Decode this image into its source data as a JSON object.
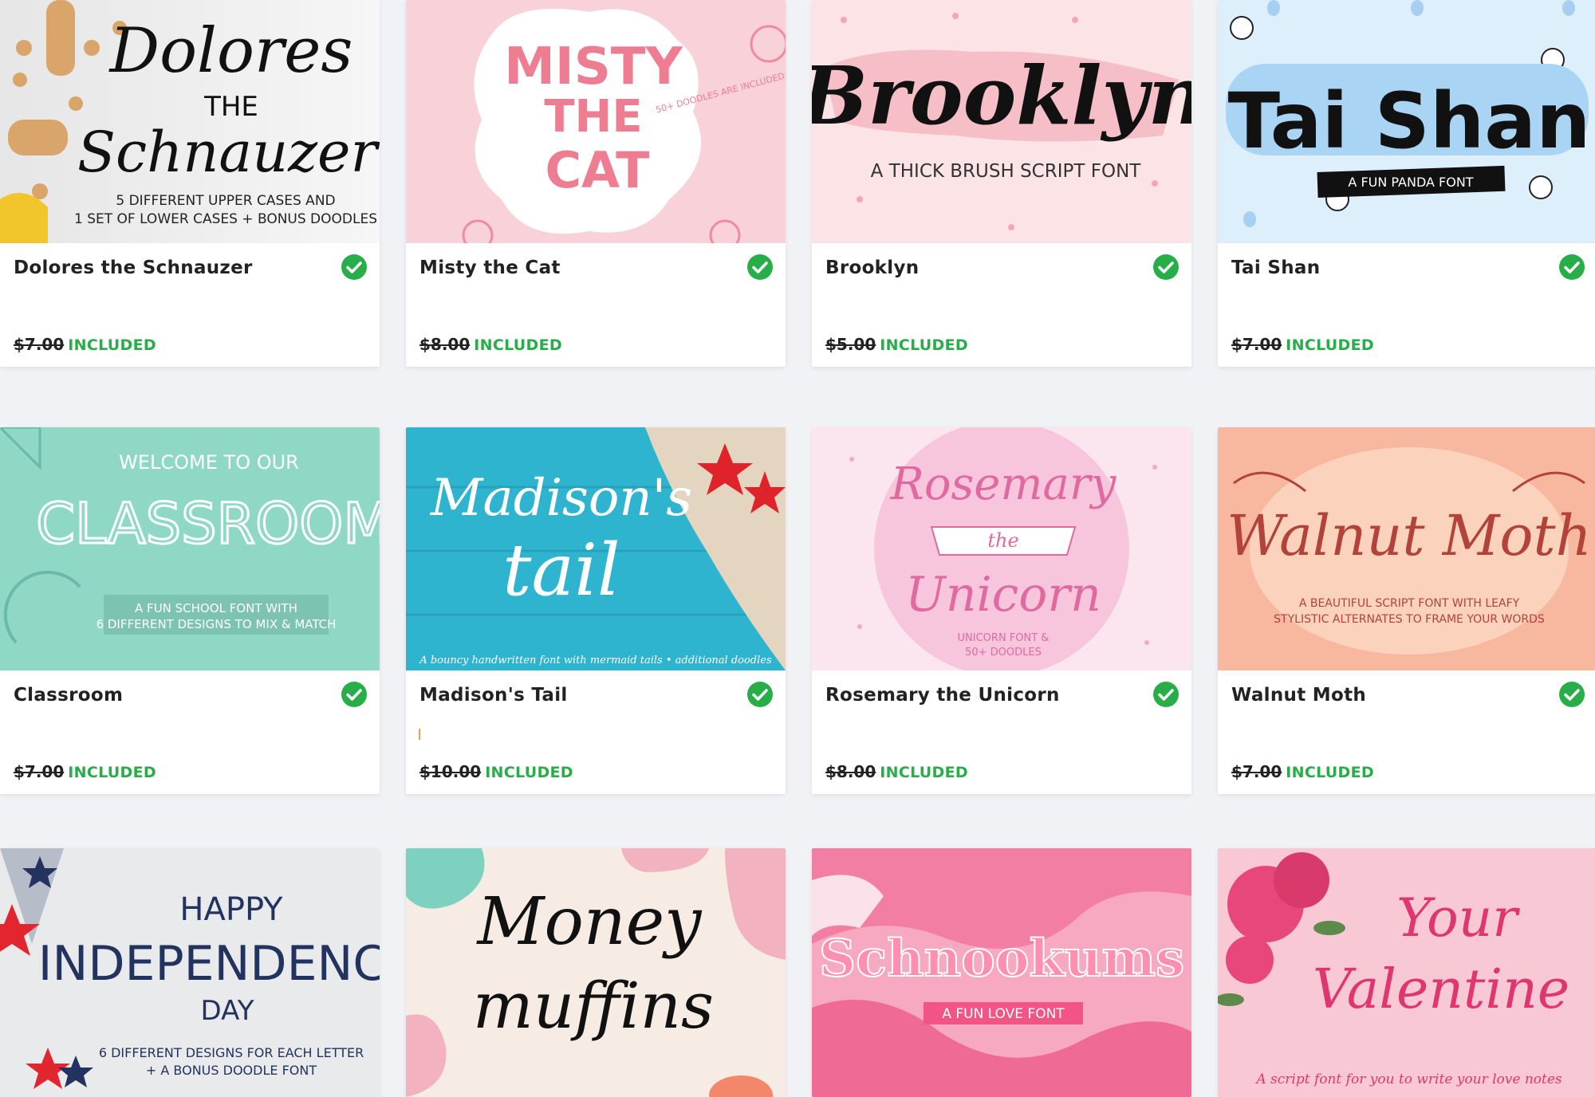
{
  "products": [
    {
      "title": "Dolores the Schnauzer",
      "price": "$7.00",
      "status": "INCLUDED",
      "thumb": {
        "lines": [
          "Dolores",
          "THE",
          "Schnauzer",
          "5 DIFFERENT UPPER CASES AND",
          "1 SET OF LOWER CASES + BONUS DOODLES"
        ]
      }
    },
    {
      "title": "Misty the Cat",
      "price": "$8.00",
      "status": "INCLUDED",
      "thumb": {
        "lines": [
          "MISTY",
          "THE",
          "CAT",
          "50+ DOODLES ARE INCLUDED"
        ]
      }
    },
    {
      "title": "Brooklyn",
      "price": "$5.00",
      "status": "INCLUDED",
      "thumb": {
        "lines": [
          "Brooklyn",
          "A THICK BRUSH SCRIPT FONT"
        ]
      }
    },
    {
      "title": "Tai Shan",
      "price": "$7.00",
      "status": "INCLUDED",
      "thumb": {
        "lines": [
          "Tai Shan",
          "A FUN PANDA FONT"
        ]
      }
    },
    {
      "title": "Classroom",
      "price": "$7.00",
      "status": "INCLUDED",
      "thumb": {
        "lines": [
          "WELCOME TO OUR",
          "CLASSROOM",
          "A FUN SCHOOL FONT WITH",
          "6 DIFFERENT DESIGNS TO MIX & MATCH"
        ]
      }
    },
    {
      "title": "Madison's Tail",
      "price": "$10.00",
      "status": "INCLUDED",
      "thumb": {
        "lines": [
          "Madison's",
          "tail",
          "A bouncy handwritten font with mermaid tails • additional doodles"
        ]
      }
    },
    {
      "title": "Rosemary the Unicorn",
      "price": "$8.00",
      "status": "INCLUDED",
      "thumb": {
        "lines": [
          "Rosemary",
          "the",
          "Unicorn",
          "UNICORN FONT &",
          "50+ DOODLES"
        ]
      }
    },
    {
      "title": "Walnut Moth",
      "price": "$7.00",
      "status": "INCLUDED",
      "thumb": {
        "lines": [
          "Walnut Moth",
          "A BEAUTIFUL SCRIPT FONT WITH LEAFY",
          "STYLISTIC ALTERNATES TO FRAME YOUR WORDS"
        ]
      }
    },
    {
      "thumb": {
        "lines": [
          "HAPPY",
          "INDEPENDENCE",
          "DAY",
          "6 DIFFERENT DESIGNS FOR EACH LETTER",
          "+ A BONUS DOODLE FONT"
        ]
      }
    },
    {
      "thumb": {
        "lines": [
          "Money",
          "muffins"
        ]
      }
    },
    {
      "thumb": {
        "lines": [
          "Schnookums",
          "A FUN LOVE FONT"
        ]
      }
    },
    {
      "thumb": {
        "lines": [
          "Your",
          "Valentine",
          "A script font for you to write your love notes"
        ]
      }
    }
  ],
  "colors": {
    "included": "#27ae48",
    "check": "#27ae48",
    "background": "#f1f2f6"
  },
  "icons": {
    "check": "check-circle-icon"
  }
}
